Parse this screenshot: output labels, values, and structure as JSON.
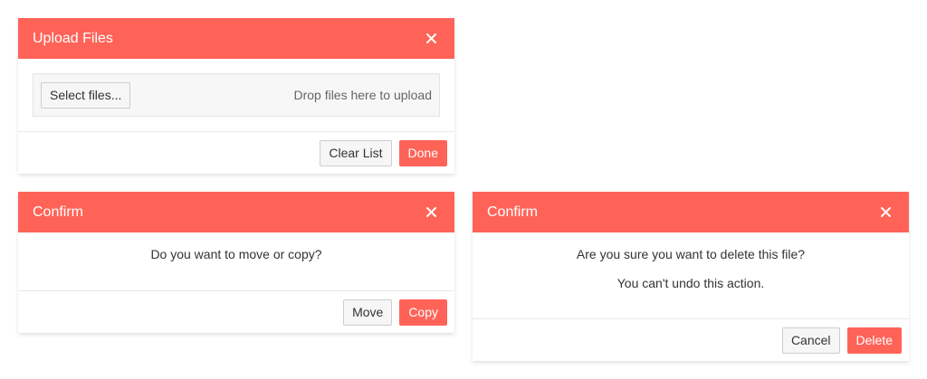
{
  "upload_dialog": {
    "title": "Upload Files",
    "select_label": "Select files...",
    "drop_hint": "Drop files here to upload",
    "clear_label": "Clear List",
    "done_label": "Done"
  },
  "confirm_move_dialog": {
    "title": "Confirm",
    "message": "Do you want to move or copy?",
    "move_label": "Move",
    "copy_label": "Copy"
  },
  "confirm_delete_dialog": {
    "title": "Confirm",
    "message": "Are you sure you want to delete this file?",
    "sub_message": "You can't undo this action.",
    "cancel_label": "Cancel",
    "delete_label": "Delete"
  },
  "colors": {
    "accent": "#ff6358",
    "header_text": "#ffffff",
    "default_button_bg": "#f6f6f6"
  },
  "icons": {
    "close": "close-icon"
  }
}
